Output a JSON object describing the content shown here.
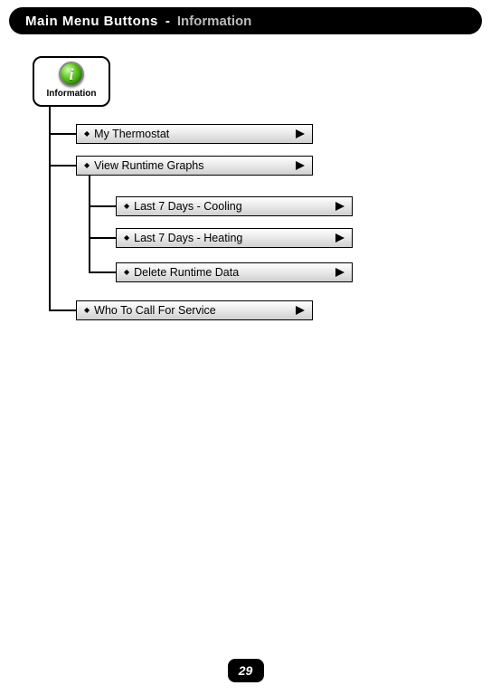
{
  "header": {
    "title_bold": "Main Menu Buttons",
    "separator": "-",
    "title_light": "Information"
  },
  "root": {
    "icon_name": "information-icon",
    "label": "Information"
  },
  "menu": {
    "my_thermostat": "My Thermostat",
    "view_runtime": "View Runtime Graphs",
    "submenu": {
      "cooling": "Last 7 Days - Cooling",
      "heating": "Last 7 Days - Heating",
      "delete": "Delete Runtime Data"
    },
    "who_to_call": "Who To Call For Service"
  },
  "page_number": "29"
}
